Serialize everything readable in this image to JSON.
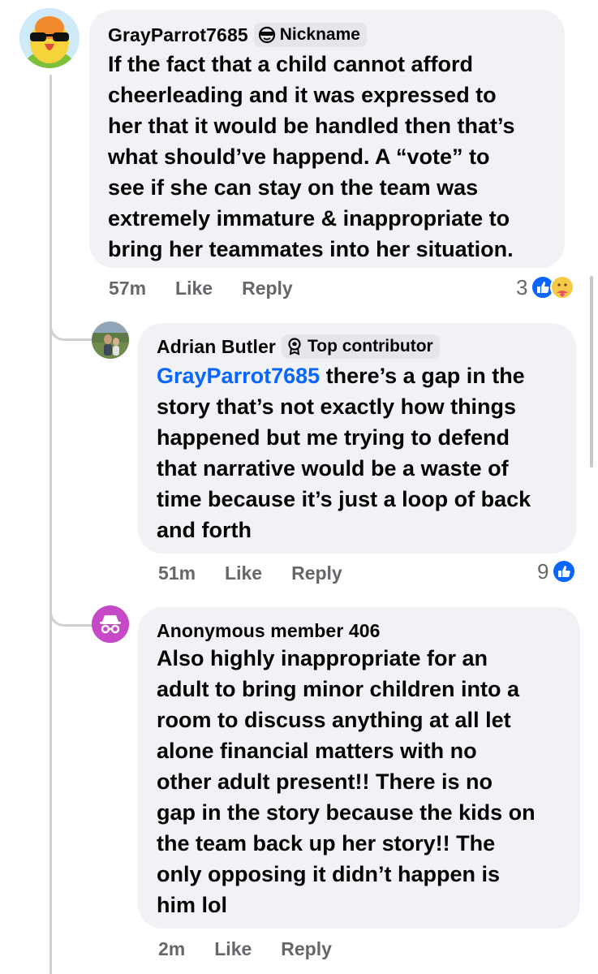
{
  "comments": [
    {
      "author": "GrayParrot7685",
      "badge": "Nickname",
      "badge_icon": "sunglasses-face-icon",
      "lines": [
        "If the fact that a child cannot afford",
        "cheerleading and it was expressed to",
        "her that it would be handled then that’s",
        "what should’ve happend. A “vote” to",
        "see if she can stay on the team was",
        "extremely immature & inappropriate to",
        "bring her teammates into her situation."
      ],
      "time": "57m",
      "like_label": "Like",
      "reply_label": "Reply",
      "reaction_count": "3",
      "reactions": [
        "like-reaction-icon",
        "care-reaction-icon"
      ]
    },
    {
      "author": "Adrian Butler",
      "badge": "Top contributor",
      "badge_icon": "award-medal-icon",
      "mention": "GrayParrot7685",
      "first_line_rest": " there’s a gap in the",
      "lines": [
        "story that’s not exactly how things",
        "happened but me trying to defend",
        "that narrative would be a waste of",
        "time because it’s just a loop of back",
        "and forth"
      ],
      "time": "51m",
      "like_label": "Like",
      "reply_label": "Reply",
      "reaction_count": "9",
      "reactions": [
        "like-reaction-icon"
      ]
    },
    {
      "author": "Anonymous member 406",
      "lines": [
        "Also highly inappropriate for an",
        "adult to bring minor children into a",
        "room to discuss anything at all let",
        "alone financial matters with no",
        "other adult present!! There is no",
        "gap in the story because the kids on",
        "the team back up her story!! The",
        "only opposing it didn’t happen is",
        "him lol"
      ],
      "time": "2m",
      "like_label": "Like",
      "reply_label": "Reply"
    }
  ],
  "colors": {
    "bubble": "#f0f2f5",
    "mention": "#0866ff",
    "meta": "#65676b",
    "thread_line": "#ced0d4",
    "anonymous_avatar": "#c64ac8",
    "like_blue": "#0866ff"
  }
}
